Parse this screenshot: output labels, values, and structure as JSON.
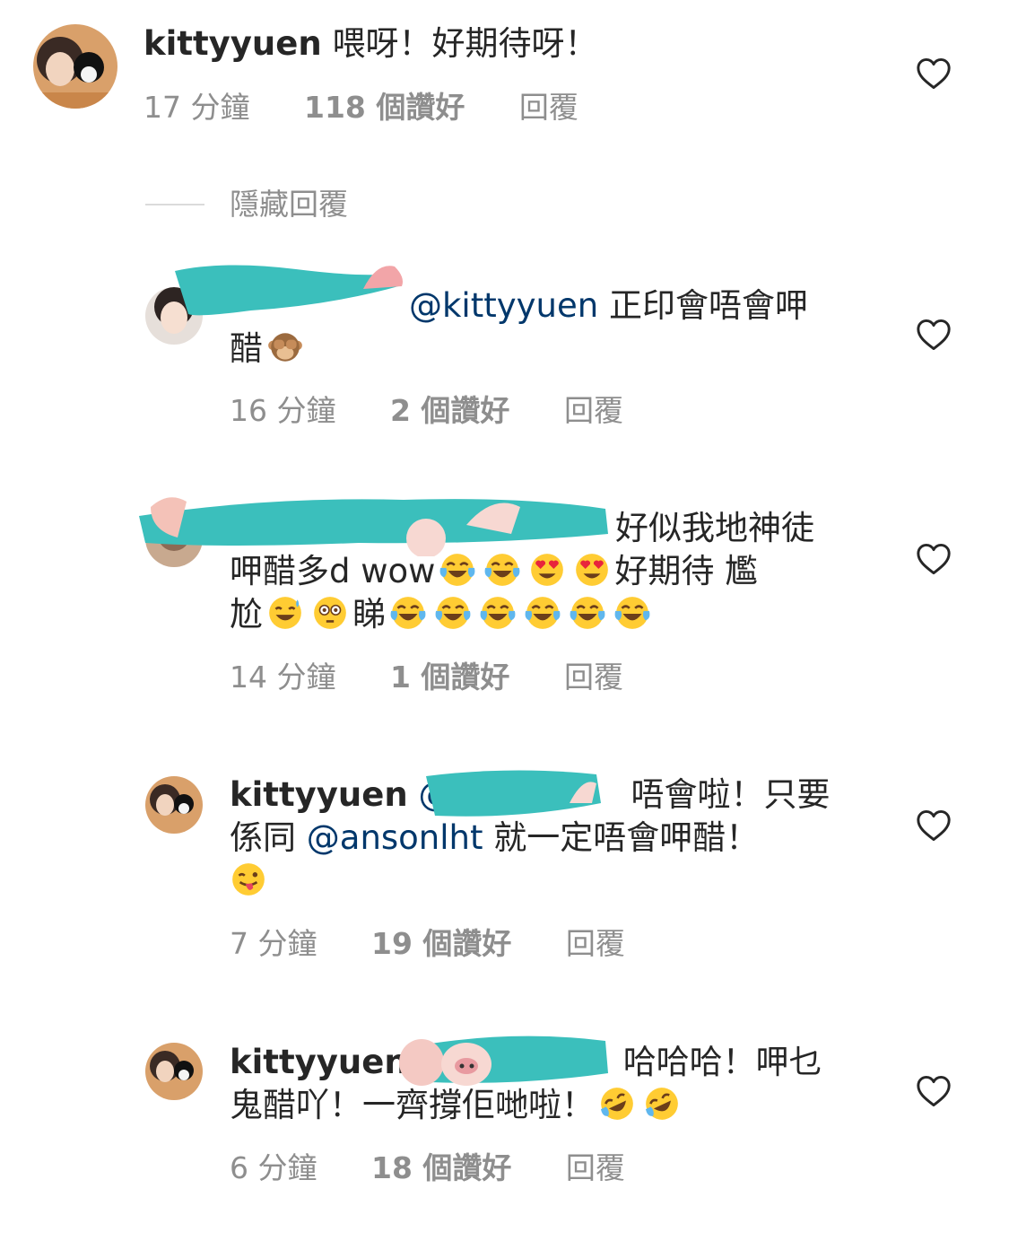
{
  "comments": [
    {
      "username": "kittyyuen",
      "text": " 喂呀！好期待呀！",
      "time": "17 分鐘",
      "likes": "118 個讚好",
      "reply": "回覆"
    },
    {
      "mention": "@kittyyuen",
      "text_line1": " 正印會唔會呷",
      "text_line2": "醋",
      "time": "16 分鐘",
      "likes": "2 個讚好",
      "reply": "回覆"
    },
    {
      "text_line1": "好似我地神徒",
      "text_line2a": "呷醋多d wow",
      "text_line2b": "好期待 尷",
      "text_line3a": "尬",
      "text_line3b": "睇",
      "time": "14 分鐘",
      "likes": "1 個讚好",
      "reply": "回覆"
    },
    {
      "username": "kittyyuen",
      "mention_prefix": "@",
      "text_line1": "唔會啦！只要",
      "text_line2a": "係同 ",
      "mention2": "@ansonlht",
      "text_line2b": " 就一定唔會呷醋！",
      "time": "7 分鐘",
      "likes": "19 個讚好",
      "reply": "回覆"
    },
    {
      "username": "kittyyuen",
      "text_line1": "哈哈哈！呷乜",
      "text_line2": "鬼醋吖！一齊撐佢哋啦！",
      "time": "6 分鐘",
      "likes": "18 個讚好",
      "reply": "回覆"
    }
  ],
  "hide_replies": "隱藏回覆",
  "icons": {
    "heart": "heart-outline-icon",
    "emoji_monkey": "see-no-evil-monkey",
    "emoji_joy": "face-with-tears-of-joy",
    "emoji_hearteyes": "smiling-face-with-heart-eyes",
    "emoji_sweat": "grinning-face-with-sweat",
    "emoji_flushed": "flushed-face",
    "emoji_wink_tongue": "winking-face-with-tongue",
    "emoji_rofl": "rolling-on-the-floor-laughing"
  },
  "colors": {
    "text": "#262626",
    "secondary": "#8e8e8e",
    "mention": "#00376b",
    "redaction": "#3bbfbc"
  }
}
